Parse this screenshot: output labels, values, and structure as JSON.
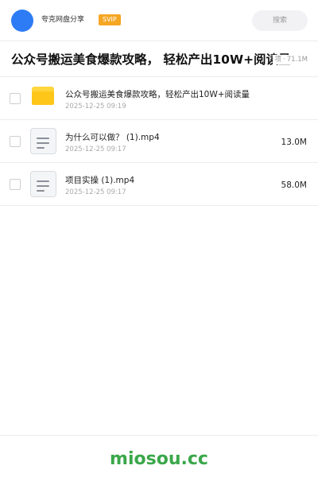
{
  "header": {
    "share_name": "夸克网盘分享",
    "badge": "SVIP",
    "search_placeholder": "搜索"
  },
  "title_bar": {
    "title": "公众号搬运美食爆款攻略， 轻松产出10W+阅读量",
    "count_text": "项",
    "dot": "·",
    "total_size": "71.1M"
  },
  "files": [
    {
      "name": "公众号搬运美食爆款攻略，轻松产出10W+阅读量",
      "date": "2025-12-25 09:19",
      "size": "",
      "icon": "folder-icon"
    },
    {
      "name": "为什么可以做？ (1).mp4",
      "date": "2025-12-25 09:17",
      "size": "13.0M",
      "icon": "video-file-icon"
    },
    {
      "name": "项目实操 (1).mp4",
      "date": "2025-12-25 09:17",
      "size": "58.0M",
      "icon": "video-file-icon"
    }
  ],
  "footer": {
    "watermark": "miosou.cc"
  },
  "colors": {
    "accent_blue": "#2d7cf6",
    "svip_orange": "#f5a623",
    "folder_yellow": "#ffc61a",
    "watermark_green": "#3aa74a"
  }
}
